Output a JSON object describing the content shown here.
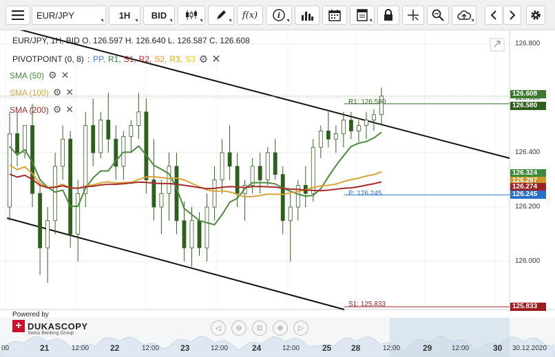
{
  "toolbar": {
    "symbol": "EUR/JPY",
    "timeframe": "1H",
    "side": "BID",
    "fx_label": "f(x)"
  },
  "legend": {
    "ohlc": "EUR/JPY, 1H, BID   O. 126.597 H. 126.640 L. 126.587 C. 126.608",
    "pivot_title": "PIVOTPOINT (0, 8)",
    "pivot_items": [
      {
        "label": "PP",
        "color": "#3a7bd5"
      },
      {
        "label": "R1",
        "color": "#2e7d32"
      },
      {
        "label": "S1",
        "color": "#c62828"
      },
      {
        "label": "R2",
        "color": "#c62828"
      },
      {
        "label": "S2",
        "color": "#ef8a1f"
      },
      {
        "label": "R3",
        "color": "#e0a800"
      },
      {
        "label": "S3",
        "color": "#e8d000"
      }
    ],
    "sma": [
      {
        "label": "SMA (50)",
        "color": "#4a8a3a"
      },
      {
        "label": "SMA (100)",
        "color": "#d9a33a"
      },
      {
        "label": "SMA (200)",
        "color": "#a52a2a"
      }
    ]
  },
  "price_axis": [
    "126.800",
    "126.600",
    "126.400",
    "126.200",
    "126.000"
  ],
  "price_tags": [
    {
      "text": "126.608",
      "color": "#3d7a2f"
    },
    {
      "text": "126.580",
      "color": "#2f5e1f"
    },
    {
      "text": "126.324",
      "color": "#3d8a3a"
    },
    {
      "text": "126.297",
      "color": "#c8962a"
    },
    {
      "text": "126.274",
      "color": "#9b2323"
    },
    {
      "text": "126.245",
      "color": "#2a6fc9"
    },
    {
      "text": "125.833",
      "color": "#9b1d1d"
    }
  ],
  "levels": {
    "r1": "R1: 126.580",
    "pp": "P: 126.245",
    "s1": "S1: 125.833"
  },
  "time_axis": [
    {
      "text": "00",
      "bold": false
    },
    {
      "text": "21",
      "bold": true
    },
    {
      "text": "12:00",
      "bold": false
    },
    {
      "text": "22",
      "bold": true
    },
    {
      "text": "12:00",
      "bold": false
    },
    {
      "text": "23",
      "bold": true
    },
    {
      "text": "12:00",
      "bold": false
    },
    {
      "text": "24",
      "bold": true
    },
    {
      "text": "12:00",
      "bold": false
    },
    {
      "text": "25",
      "bold": true
    },
    {
      "text": "28",
      "bold": true
    },
    {
      "text": "12:00",
      "bold": false
    },
    {
      "text": "29",
      "bold": true
    },
    {
      "text": "12:00",
      "bold": false
    },
    {
      "text": "30",
      "bold": true
    },
    {
      "text": "30.12.2020",
      "bold": false
    }
  ],
  "branding": {
    "powered_by": "Powered by",
    "brand": "DUKASCOPY",
    "tagline": "Swiss Banking Group"
  },
  "chart_data": {
    "type": "candlestick",
    "symbol": "EUR/JPY",
    "timeframe": "1H",
    "ylim": [
      125.85,
      126.85
    ],
    "candles": [
      [
        126.2,
        126.55,
        126.15,
        126.47
      ],
      [
        126.47,
        126.55,
        126.35,
        126.4
      ],
      [
        126.4,
        126.5,
        126.38,
        126.5
      ],
      [
        126.5,
        126.58,
        126.2,
        126.25
      ],
      [
        126.25,
        126.28,
        125.95,
        126.05
      ],
      [
        126.05,
        126.2,
        125.92,
        126.15
      ],
      [
        126.15,
        126.4,
        126.1,
        126.35
      ],
      [
        126.35,
        126.5,
        126.3,
        126.45
      ],
      [
        126.45,
        126.48,
        126.05,
        126.1
      ],
      [
        126.1,
        126.3,
        126.0,
        126.25
      ],
      [
        126.25,
        126.55,
        126.2,
        126.5
      ],
      [
        126.5,
        126.6,
        126.35,
        126.4
      ],
      [
        126.4,
        126.55,
        126.38,
        126.52
      ],
      [
        126.52,
        126.62,
        126.4,
        126.45
      ],
      [
        126.45,
        126.5,
        126.3,
        126.35
      ],
      [
        126.35,
        126.48,
        126.3,
        126.46
      ],
      [
        126.46,
        126.52,
        126.4,
        126.5
      ],
      [
        126.5,
        126.62,
        126.45,
        126.55
      ],
      [
        126.55,
        126.6,
        126.25,
        126.3
      ],
      [
        126.3,
        126.45,
        126.15,
        126.2
      ],
      [
        126.2,
        126.3,
        126.1,
        126.25
      ],
      [
        126.25,
        126.4,
        126.15,
        126.35
      ],
      [
        126.35,
        126.4,
        126.1,
        126.15
      ],
      [
        126.15,
        126.22,
        126.0,
        126.05
      ],
      [
        126.05,
        126.2,
        125.98,
        126.15
      ],
      [
        126.15,
        126.18,
        126.02,
        126.05
      ],
      [
        126.05,
        126.25,
        126.0,
        126.2
      ],
      [
        126.2,
        126.35,
        126.15,
        126.3
      ],
      [
        126.3,
        126.45,
        126.25,
        126.4
      ],
      [
        126.4,
        126.5,
        126.3,
        126.35
      ],
      [
        126.35,
        126.4,
        126.2,
        126.25
      ],
      [
        126.25,
        126.3,
        126.15,
        126.28
      ],
      [
        126.28,
        126.38,
        126.25,
        126.35
      ],
      [
        126.35,
        126.4,
        126.25,
        126.3
      ],
      [
        126.3,
        126.42,
        126.28,
        126.4
      ],
      [
        126.4,
        126.45,
        126.3,
        126.32
      ],
      [
        126.32,
        126.35,
        126.1,
        126.15
      ],
      [
        126.15,
        126.25,
        126.0,
        126.2
      ],
      [
        126.2,
        126.3,
        126.15,
        126.28
      ],
      [
        126.28,
        126.35,
        126.2,
        126.25
      ],
      [
        126.25,
        126.45,
        126.22,
        126.42
      ],
      [
        126.42,
        126.5,
        126.38,
        126.48
      ],
      [
        126.48,
        126.55,
        126.42,
        126.45
      ],
      [
        126.45,
        126.5,
        126.4,
        126.47
      ],
      [
        126.47,
        126.55,
        126.42,
        126.52
      ],
      [
        126.52,
        126.55,
        126.45,
        126.48
      ],
      [
        126.48,
        126.52,
        126.44,
        126.5
      ],
      [
        126.5,
        126.55,
        126.45,
        126.52
      ],
      [
        126.52,
        126.56,
        126.48,
        126.54
      ],
      [
        126.54,
        126.64,
        126.5,
        126.608
      ]
    ]
  }
}
